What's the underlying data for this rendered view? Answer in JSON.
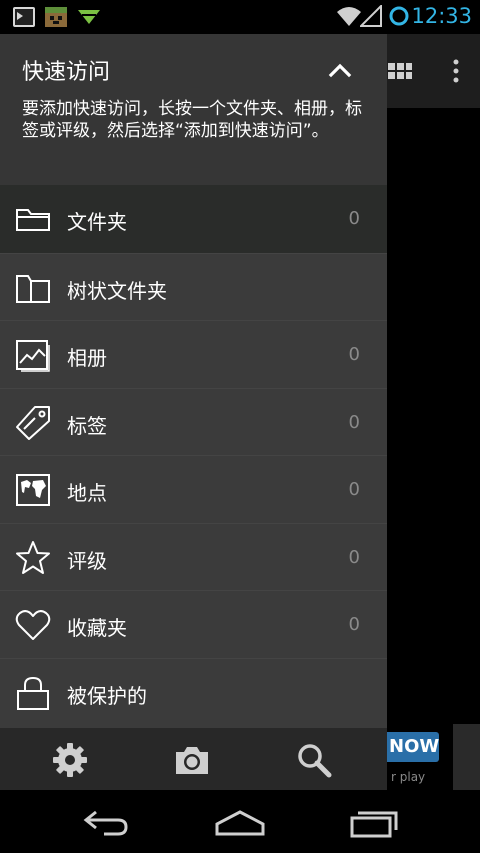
{
  "status_bar": {
    "time": "12:33",
    "notification_icons": [
      "terminal-icon",
      "game-icon",
      "download-icon"
    ],
    "system_icons": [
      "wifi-icon",
      "signal-icon",
      "sync-icon"
    ],
    "accent_color": "#33b5e5"
  },
  "background_app": {
    "ad_button_label": "NOW",
    "ad_subtext": "r play"
  },
  "quick_access": {
    "title": "快速访问",
    "description": "要添加快速访问，长按一个文件夹、相册，标签或评级，然后选择“添加到快速访问”。"
  },
  "menu": {
    "items": [
      {
        "label": "文件夹",
        "count": "0",
        "icon": "folder-icon"
      },
      {
        "label": "树状文件夹",
        "count": "",
        "icon": "folder-tree-icon"
      },
      {
        "label": "相册",
        "count": "0",
        "icon": "album-icon"
      },
      {
        "label": "标签",
        "count": "0",
        "icon": "tag-icon"
      },
      {
        "label": "地点",
        "count": "0",
        "icon": "map-icon"
      },
      {
        "label": "评级",
        "count": "0",
        "icon": "star-icon"
      },
      {
        "label": "收藏夹",
        "count": "0",
        "icon": "heart-icon"
      },
      {
        "label": "被保护的",
        "count": "",
        "icon": "lock-icon"
      }
    ]
  },
  "bottom_bar": {
    "buttons": [
      "settings-icon",
      "camera-icon",
      "search-icon"
    ]
  },
  "nav_bar": {
    "buttons": [
      "back-icon",
      "home-icon",
      "recents-icon"
    ]
  }
}
